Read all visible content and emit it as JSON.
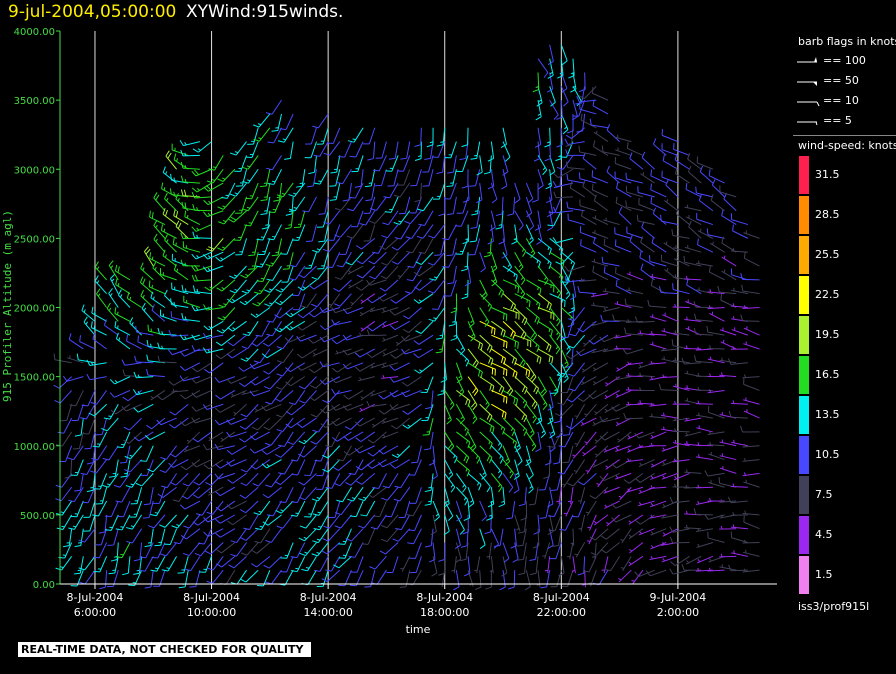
{
  "header": {
    "date_time": "9-jul-2004,05:00:00",
    "title": "XYWind:915winds."
  },
  "legend": {
    "flags_title": "barb flags in knots",
    "flags": [
      {
        "label": "== 100",
        "kind": "pennant"
      },
      {
        "label": "== 50",
        "kind": "flag"
      },
      {
        "label": "== 10",
        "kind": "full"
      },
      {
        "label": "== 5",
        "kind": "half"
      }
    ],
    "speed_title": "wind-speed: knots",
    "speed_bins": [
      {
        "label": "31.5",
        "color": "#ff2050"
      },
      {
        "label": "28.5",
        "color": "#ff8c00"
      },
      {
        "label": "25.5",
        "color": "#ffaa00"
      },
      {
        "label": "22.5",
        "color": "#ffff00"
      },
      {
        "label": "19.5",
        "color": "#a8f030"
      },
      {
        "label": "16.5",
        "color": "#22dd22"
      },
      {
        "label": "13.5",
        "color": "#00f0f0"
      },
      {
        "label": "10.5",
        "color": "#4848ff"
      },
      {
        "label": "7.5",
        "color": "#404058"
      },
      {
        "label": "4.5",
        "color": "#9a28f0"
      },
      {
        "label": "1.5",
        "color": "#f080f0"
      }
    ],
    "station": "iss3/prof915l"
  },
  "notice": "REAL-TIME DATA, NOT CHECKED FOR QUALITY",
  "chart_data": {
    "type": "wind-barb time-height",
    "xlabel": "time",
    "ylabel": "915 Profiler Altitude (m agl)",
    "ylim": [
      0,
      4000
    ],
    "yticks": [
      "0.00",
      "500.00",
      "1000.00",
      "1500.00",
      "2000.00",
      "2500.00",
      "3000.00",
      "3500.00",
      "4000.00"
    ],
    "x_range_hours": [
      4.8,
      5.4
    ],
    "x_range_note": "",
    "xticks": [
      {
        "hour": 6,
        "line1": "8-Jul-2004",
        "line2": "6:00:00"
      },
      {
        "hour": 10,
        "line1": "8-Jul-2004",
        "line2": "10:00:00"
      },
      {
        "hour": 14,
        "line1": "8-Jul-2004",
        "line2": "14:00:00"
      },
      {
        "hour": 18,
        "line1": "8-Jul-2004",
        "line2": "18:00:00"
      },
      {
        "hour": 22,
        "line1": "8-Jul-2004",
        "line2": "22:00:00"
      },
      {
        "hour": 26,
        "line1": "9-Jul-2004",
        "line2": "2:00:00"
      }
    ],
    "grid": "vertical lines at x ticks",
    "profile_start_hour": 5.2,
    "profile_step_hours": 0.4,
    "profile_count": 60,
    "gate_step_m": 100,
    "series_top_m": [
      1600,
      1700,
      1900,
      2200,
      2300,
      2200,
      2100,
      2300,
      2700,
      3000,
      3100,
      3200,
      3200,
      3100,
      3000,
      3200,
      3300,
      3400,
      3500,
      3400,
      3300,
      3300,
      3400,
      3300,
      3200,
      3300,
      3300,
      3300,
      3200,
      3200,
      3300,
      3300,
      3300,
      3200,
      3300,
      3200,
      3200,
      3300,
      3100,
      2900,
      3900,
      3900,
      3900,
      3800,
      3700,
      3600,
      3500,
      3300,
      3200,
      3100,
      3000,
      3100,
      3200,
      3100,
      3000,
      3000,
      2900,
      2800,
      2700,
      2500
    ],
    "cores": [
      {
        "hour": 7.5,
        "alt": 400,
        "speed": 14,
        "dir": 200
      },
      {
        "hour": 8.5,
        "alt": 2500,
        "speed": 18,
        "dir": 320
      },
      {
        "hour": 10.5,
        "alt": 1200,
        "speed": 8,
        "dir": 250
      },
      {
        "hour": 11.5,
        "alt": 2600,
        "speed": 17,
        "dir": 200
      },
      {
        "hour": 13.5,
        "alt": 800,
        "speed": 13,
        "dir": 210
      },
      {
        "hour": 14.5,
        "alt": 2900,
        "speed": 12,
        "dir": 200
      },
      {
        "hour": 16.0,
        "alt": 1800,
        "speed": 6,
        "dir": 260
      },
      {
        "hour": 17.0,
        "alt": 3000,
        "speed": 11,
        "dir": 200
      },
      {
        "hour": 19.5,
        "alt": 3700,
        "speed": 15,
        "dir": 160
      },
      {
        "hour": 19.8,
        "alt": 1500,
        "speed": 24,
        "dir": 120
      },
      {
        "hour": 21.5,
        "alt": 600,
        "speed": 8,
        "dir": 180
      },
      {
        "hour": 24.0,
        "alt": 1100,
        "speed": 5,
        "dir": 250
      },
      {
        "hour": 26.0,
        "alt": 2800,
        "speed": 10,
        "dir": 300
      },
      {
        "hour": 27.5,
        "alt": 1600,
        "speed": 6,
        "dir": 280
      }
    ]
  }
}
